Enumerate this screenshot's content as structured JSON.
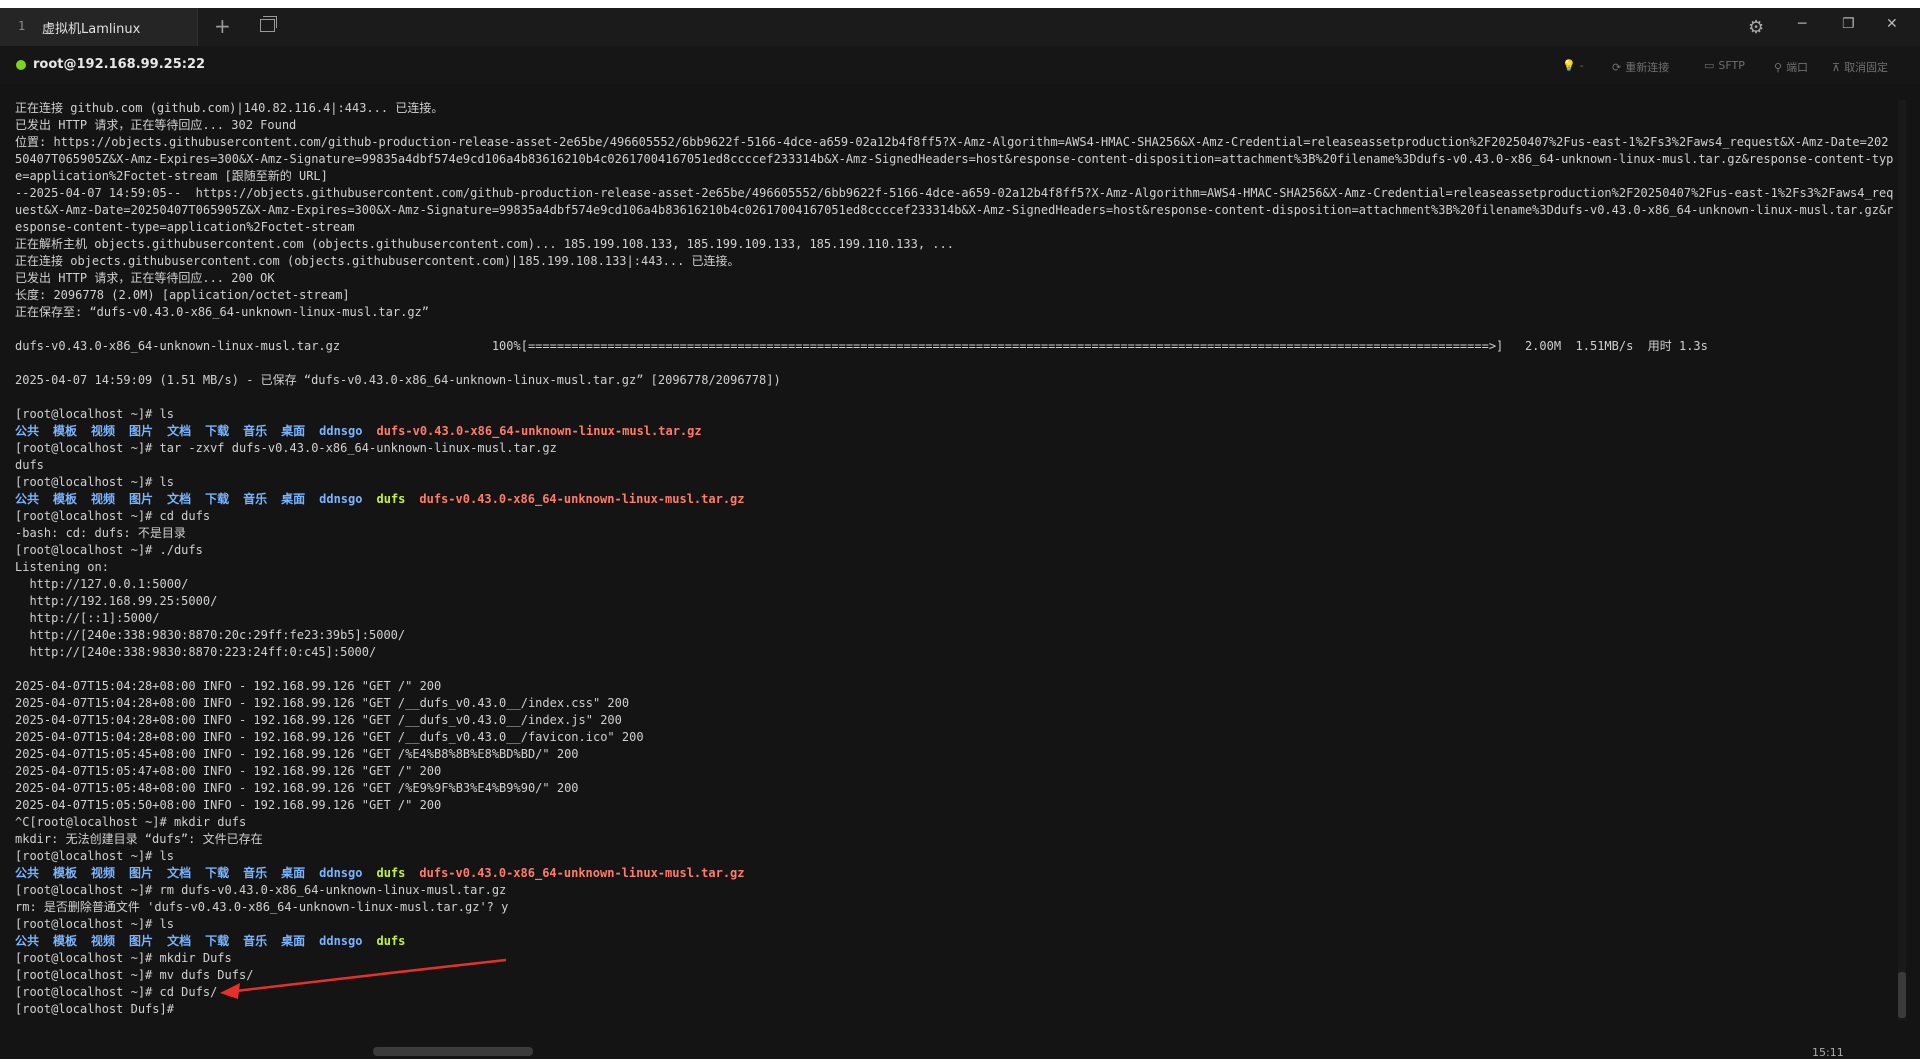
{
  "tabbar": {
    "tab_number": "1",
    "tab_title": "虚拟机Lamlinux",
    "add_label": "+",
    "settings_icon": "gear-icon",
    "minimize_label": "─",
    "maximize_label": "❐",
    "close_label": "✕"
  },
  "session": {
    "title": "root@192.168.99.25:22",
    "status_color": "#7ed321",
    "toolbar": [
      {
        "icon": "lightbulb-icon",
        "glyph": "💡",
        "label": "-"
      },
      {
        "icon": "reconnect-icon",
        "glyph": "⟳",
        "label": "重新连接"
      },
      {
        "icon": "sftp-icon",
        "glyph": "▭",
        "label": "SFTP"
      },
      {
        "icon": "port-icon",
        "glyph": "⚲",
        "label": "端口"
      },
      {
        "icon": "pin-icon",
        "glyph": "⊼",
        "label": "取消固定"
      }
    ]
  },
  "terminal": {
    "lines": [
      {
        "t": "text",
        "text": "正在连接 github.com (github.com)|140.82.116.4|:443... 已连接。"
      },
      {
        "t": "text",
        "text": "已发出 HTTP 请求，正在等待回应... 302 Found"
      },
      {
        "t": "wrap",
        "text": "位置: https://objects.githubusercontent.com/github-production-release-asset-2e65be/496605552/6bb9622f-5166-4dce-a659-02a12b4f8ff5?X-Amz-Algorithm=AWS4-HMAC-SHA256&X-Amz-Credential=releaseassetproduction%2F20250407%2Fus-east-1%2Fs3%2Faws4_request&X-Amz-Date=20250407T065905Z&X-Amz-Expires=300&X-Amz-Signature=99835a4dbf574e9cd106a4b83616210b4c02617004167051ed8ccccef233314b&X-Amz-SignedHeaders=host&response-content-disposition=attachment%3B%20filename%3Ddufs-v0.43.0-x86_64-unknown-linux-musl.tar.gz&response-content-type=application%2Foctet-stream [跟随至新的 URL]"
      },
      {
        "t": "wrap",
        "text": "--2025-04-07 14:59:05--  https://objects.githubusercontent.com/github-production-release-asset-2e65be/496605552/6bb9622f-5166-4dce-a659-02a12b4f8ff5?X-Amz-Algorithm=AWS4-HMAC-SHA256&X-Amz-Credential=releaseassetproduction%2F20250407%2Fus-east-1%2Fs3%2Faws4_request&X-Amz-Date=20250407T065905Z&X-Amz-Expires=300&X-Amz-Signature=99835a4dbf574e9cd106a4b83616210b4c02617004167051ed8ccccef233314b&X-Amz-SignedHeaders=host&response-content-disposition=attachment%3B%20filename%3Ddufs-v0.43.0-x86_64-unknown-linux-musl.tar.gz&response-content-type=application%2Foctet-stream"
      },
      {
        "t": "text",
        "text": "正在解析主机 objects.githubusercontent.com (objects.githubusercontent.com)... 185.199.108.133, 185.199.109.133, 185.199.110.133, ..."
      },
      {
        "t": "text",
        "text": "正在连接 objects.githubusercontent.com (objects.githubusercontent.com)|185.199.108.133|:443... 已连接。"
      },
      {
        "t": "text",
        "text": "已发出 HTTP 请求，正在等待回应... 200 OK"
      },
      {
        "t": "text",
        "text": "长度: 2096778 (2.0M) [application/octet-stream]"
      },
      {
        "t": "text",
        "text": "正在保存至: “dufs-v0.43.0-x86_64-unknown-linux-musl.tar.gz”"
      },
      {
        "t": "text",
        "text": ""
      },
      {
        "t": "text",
        "text": "dufs-v0.43.0-x86_64-unknown-linux-musl.tar.gz                     100%[=====================================================================================================================================>]   2.00M  1.51MB/s  用时 1.3s"
      },
      {
        "t": "text",
        "text": ""
      },
      {
        "t": "text",
        "text": "2025-04-07 14:59:09 (1.51 MB/s) - 已保存 “dufs-v0.43.0-x86_64-unknown-linux-musl.tar.gz” [2096778/2096778])"
      },
      {
        "t": "text",
        "text": ""
      },
      {
        "t": "text",
        "text": "[root@localhost ~]# ls"
      },
      {
        "t": "ls",
        "items": [
          [
            "公共",
            "dir"
          ],
          [
            "模板",
            "dir"
          ],
          [
            "视频",
            "dir"
          ],
          [
            "图片",
            "dir"
          ],
          [
            "文档",
            "dir"
          ],
          [
            "下载",
            "dir"
          ],
          [
            "音乐",
            "dir"
          ],
          [
            "桌面",
            "dir"
          ],
          [
            "ddnsgo",
            "dir"
          ],
          [
            "dufs-v0.43.0-x86_64-unknown-linux-musl.tar.gz",
            "arch"
          ]
        ]
      },
      {
        "t": "text",
        "text": "[root@localhost ~]# tar -zxvf dufs-v0.43.0-x86_64-unknown-linux-musl.tar.gz"
      },
      {
        "t": "text",
        "text": "dufs"
      },
      {
        "t": "text",
        "text": "[root@localhost ~]# ls"
      },
      {
        "t": "ls",
        "items": [
          [
            "公共",
            "dir"
          ],
          [
            "模板",
            "dir"
          ],
          [
            "视频",
            "dir"
          ],
          [
            "图片",
            "dir"
          ],
          [
            "文档",
            "dir"
          ],
          [
            "下载",
            "dir"
          ],
          [
            "音乐",
            "dir"
          ],
          [
            "桌面",
            "dir"
          ],
          [
            "ddnsgo",
            "dir"
          ],
          [
            "dufs",
            "exe"
          ],
          [
            "dufs-v0.43.0-x86_64-unknown-linux-musl.tar.gz",
            "arch"
          ]
        ]
      },
      {
        "t": "text",
        "text": "[root@localhost ~]# cd dufs"
      },
      {
        "t": "text",
        "text": "-bash: cd: dufs: 不是目录"
      },
      {
        "t": "text",
        "text": "[root@localhost ~]# ./dufs"
      },
      {
        "t": "text",
        "text": "Listening on:"
      },
      {
        "t": "text",
        "text": "  http://127.0.0.1:5000/"
      },
      {
        "t": "text",
        "text": "  http://192.168.99.25:5000/"
      },
      {
        "t": "text",
        "text": "  http://[::1]:5000/"
      },
      {
        "t": "text",
        "text": "  http://[240e:338:9830:8870:20c:29ff:fe23:39b5]:5000/"
      },
      {
        "t": "text",
        "text": "  http://[240e:338:9830:8870:223:24ff:0:c45]:5000/"
      },
      {
        "t": "text",
        "text": ""
      },
      {
        "t": "text",
        "text": "2025-04-07T15:04:28+08:00 INFO - 192.168.99.126 \"GET /\" 200"
      },
      {
        "t": "text",
        "text": "2025-04-07T15:04:28+08:00 INFO - 192.168.99.126 \"GET /__dufs_v0.43.0__/index.css\" 200"
      },
      {
        "t": "text",
        "text": "2025-04-07T15:04:28+08:00 INFO - 192.168.99.126 \"GET /__dufs_v0.43.0__/index.js\" 200"
      },
      {
        "t": "text",
        "text": "2025-04-07T15:04:28+08:00 INFO - 192.168.99.126 \"GET /__dufs_v0.43.0__/favicon.ico\" 200"
      },
      {
        "t": "text",
        "text": "2025-04-07T15:05:45+08:00 INFO - 192.168.99.126 \"GET /%E4%B8%8B%E8%BD%BD/\" 200"
      },
      {
        "t": "text",
        "text": "2025-04-07T15:05:47+08:00 INFO - 192.168.99.126 \"GET /\" 200"
      },
      {
        "t": "text",
        "text": "2025-04-07T15:05:48+08:00 INFO - 192.168.99.126 \"GET /%E9%9F%B3%E4%B9%90/\" 200"
      },
      {
        "t": "text",
        "text": "2025-04-07T15:05:50+08:00 INFO - 192.168.99.126 \"GET /\" 200"
      },
      {
        "t": "text",
        "text": "^C[root@localhost ~]# mkdir dufs"
      },
      {
        "t": "text",
        "text": "mkdir: 无法创建目录 “dufs”: 文件已存在"
      },
      {
        "t": "text",
        "text": "[root@localhost ~]# ls"
      },
      {
        "t": "ls",
        "items": [
          [
            "公共",
            "dir"
          ],
          [
            "模板",
            "dir"
          ],
          [
            "视频",
            "dir"
          ],
          [
            "图片",
            "dir"
          ],
          [
            "文档",
            "dir"
          ],
          [
            "下载",
            "dir"
          ],
          [
            "音乐",
            "dir"
          ],
          [
            "桌面",
            "dir"
          ],
          [
            "ddnsgo",
            "dir"
          ],
          [
            "dufs",
            "exe"
          ],
          [
            "dufs-v0.43.0-x86_64-unknown-linux-musl.tar.gz",
            "arch"
          ]
        ]
      },
      {
        "t": "text",
        "text": "[root@localhost ~]# rm dufs-v0.43.0-x86_64-unknown-linux-musl.tar.gz"
      },
      {
        "t": "text",
        "text": "rm: 是否删除普通文件 'dufs-v0.43.0-x86_64-unknown-linux-musl.tar.gz'? y"
      },
      {
        "t": "text",
        "text": "[root@localhost ~]# ls"
      },
      {
        "t": "ls",
        "items": [
          [
            "公共",
            "dir"
          ],
          [
            "模板",
            "dir"
          ],
          [
            "视频",
            "dir"
          ],
          [
            "图片",
            "dir"
          ],
          [
            "文档",
            "dir"
          ],
          [
            "下载",
            "dir"
          ],
          [
            "音乐",
            "dir"
          ],
          [
            "桌面",
            "dir"
          ],
          [
            "ddnsgo",
            "dir"
          ],
          [
            "dufs",
            "exe"
          ]
        ]
      },
      {
        "t": "text",
        "text": "[root@localhost ~]# mkdir Dufs"
      },
      {
        "t": "text",
        "text": "[root@localhost ~]# mv dufs Dufs/"
      },
      {
        "t": "text",
        "text": "[root@localhost ~]# cd Dufs/"
      },
      {
        "t": "text",
        "text": "[root@localhost Dufs]#"
      }
    ]
  },
  "annotation": {
    "arrow_color": "#e8302a"
  },
  "taskbar": {
    "clock": "15:11"
  }
}
